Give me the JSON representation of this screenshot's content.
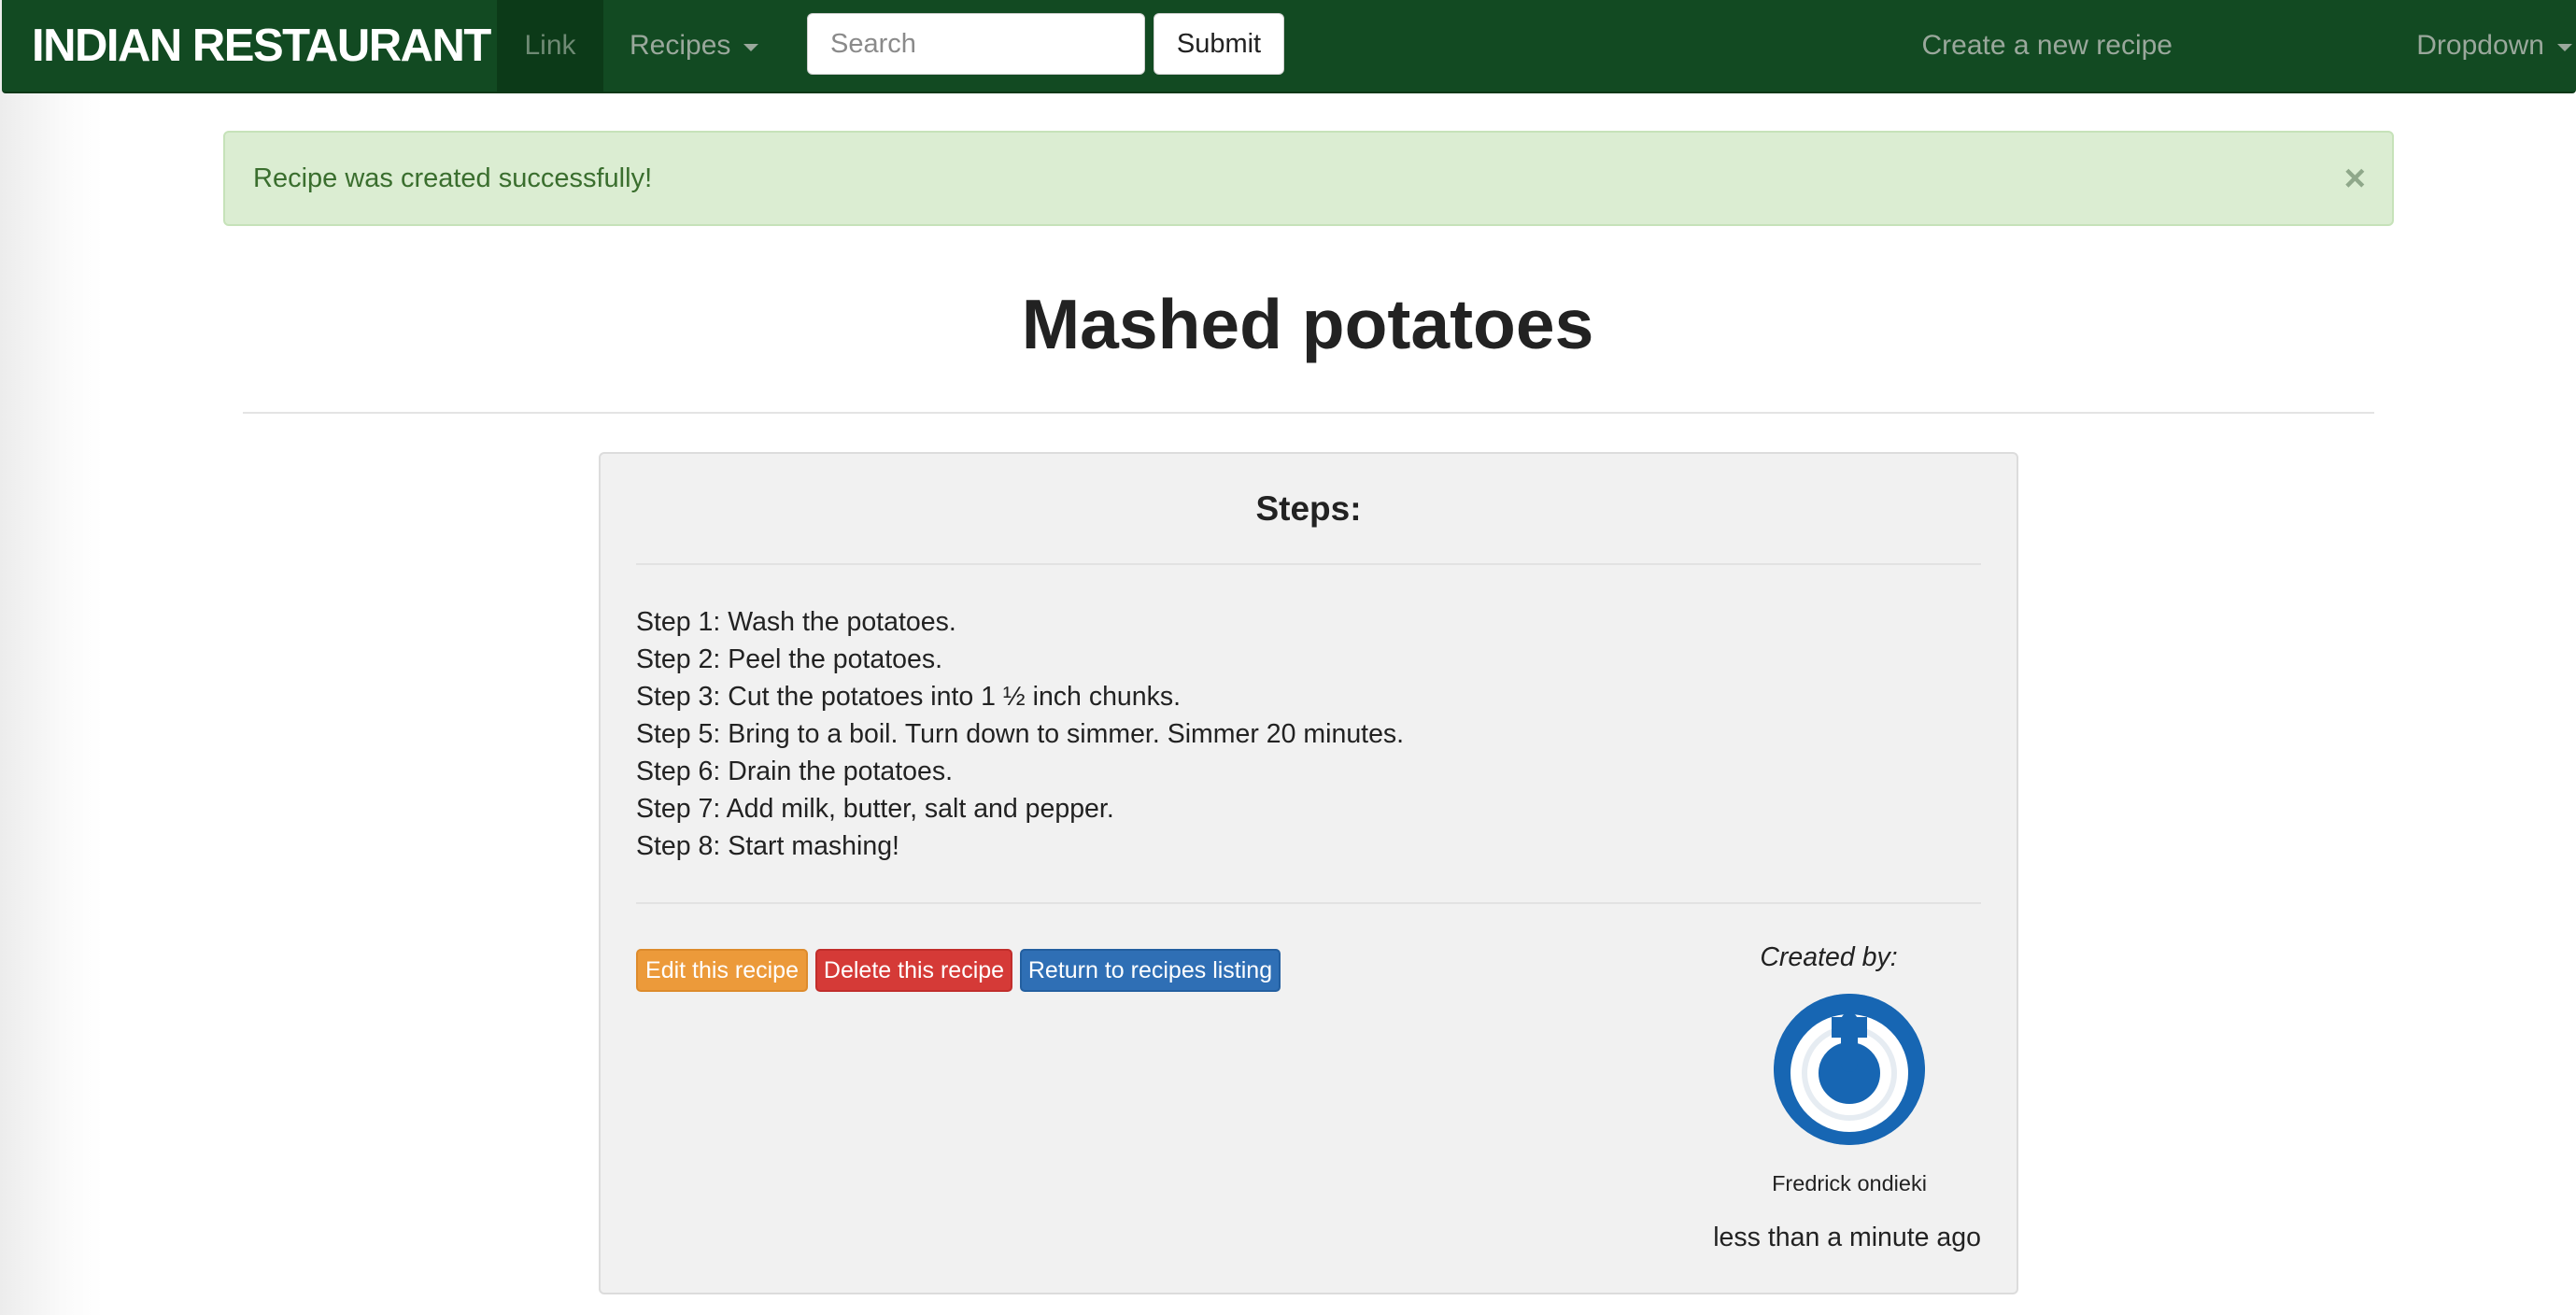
{
  "navbar": {
    "brand": "INDIAN RESTAURANT",
    "link_label": "Link",
    "recipes_label": "Recipes",
    "search_placeholder": "Search",
    "submit_label": "Submit",
    "create_label": "Create a new recipe",
    "dropdown_label": "Dropdown"
  },
  "alert": {
    "message": "Recipe was created successfully!",
    "close_glyph": "×"
  },
  "recipe": {
    "title": "Mashed potatoes",
    "steps_heading": "Steps:",
    "steps": [
      "Step 1: Wash the potatoes.",
      "Step 2: Peel the potatoes.",
      "Step 3: Cut the potatoes into 1 ½ inch chunks.",
      "Step 5: Bring to a boil. Turn down to simmer. Simmer 20 minutes.",
      "Step 6: Drain the potatoes.",
      "Step 7: Add milk, butter, salt and pepper.",
      "Step 8: Start mashing!"
    ]
  },
  "actions": {
    "edit_label": "Edit this recipe",
    "delete_label": "Delete this recipe",
    "return_label": "Return to recipes listing"
  },
  "author": {
    "created_by_label": "Created by:",
    "name": "Fredrick ondieki",
    "time_ago": "less than a minute ago",
    "avatar_icon": "power-icon"
  },
  "colors": {
    "navbar_bg": "#124a22",
    "alert_bg": "#dbedd2",
    "alert_text": "#3a6e2e",
    "edit_button": "#ec9a3a",
    "delete_button": "#d53a37",
    "return_button": "#2f6fb5",
    "avatar": "#1766b3"
  }
}
